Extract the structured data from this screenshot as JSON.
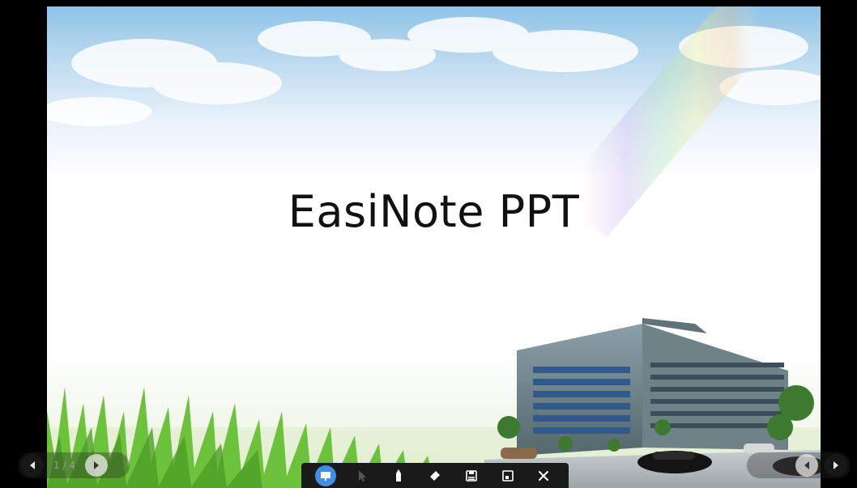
{
  "slide": {
    "title": "EasiNote PPT"
  },
  "navigation": {
    "prev_icon": "triangle-left-icon",
    "next_icon": "triangle-right-icon",
    "page_current": "1",
    "page_separator": "/",
    "page_total": "4"
  },
  "toolbar": {
    "items": [
      {
        "name": "presentation-icon",
        "active": true
      },
      {
        "name": "pointer-icon",
        "active": false
      },
      {
        "name": "pen-icon",
        "active": false
      },
      {
        "name": "eraser-icon",
        "active": false
      },
      {
        "name": "save-icon",
        "active": false
      },
      {
        "name": "minimize-icon",
        "active": false
      },
      {
        "name": "close-icon",
        "active": false
      }
    ],
    "active_color": "#3f8fe6",
    "background_color": "#1a1a1a"
  }
}
